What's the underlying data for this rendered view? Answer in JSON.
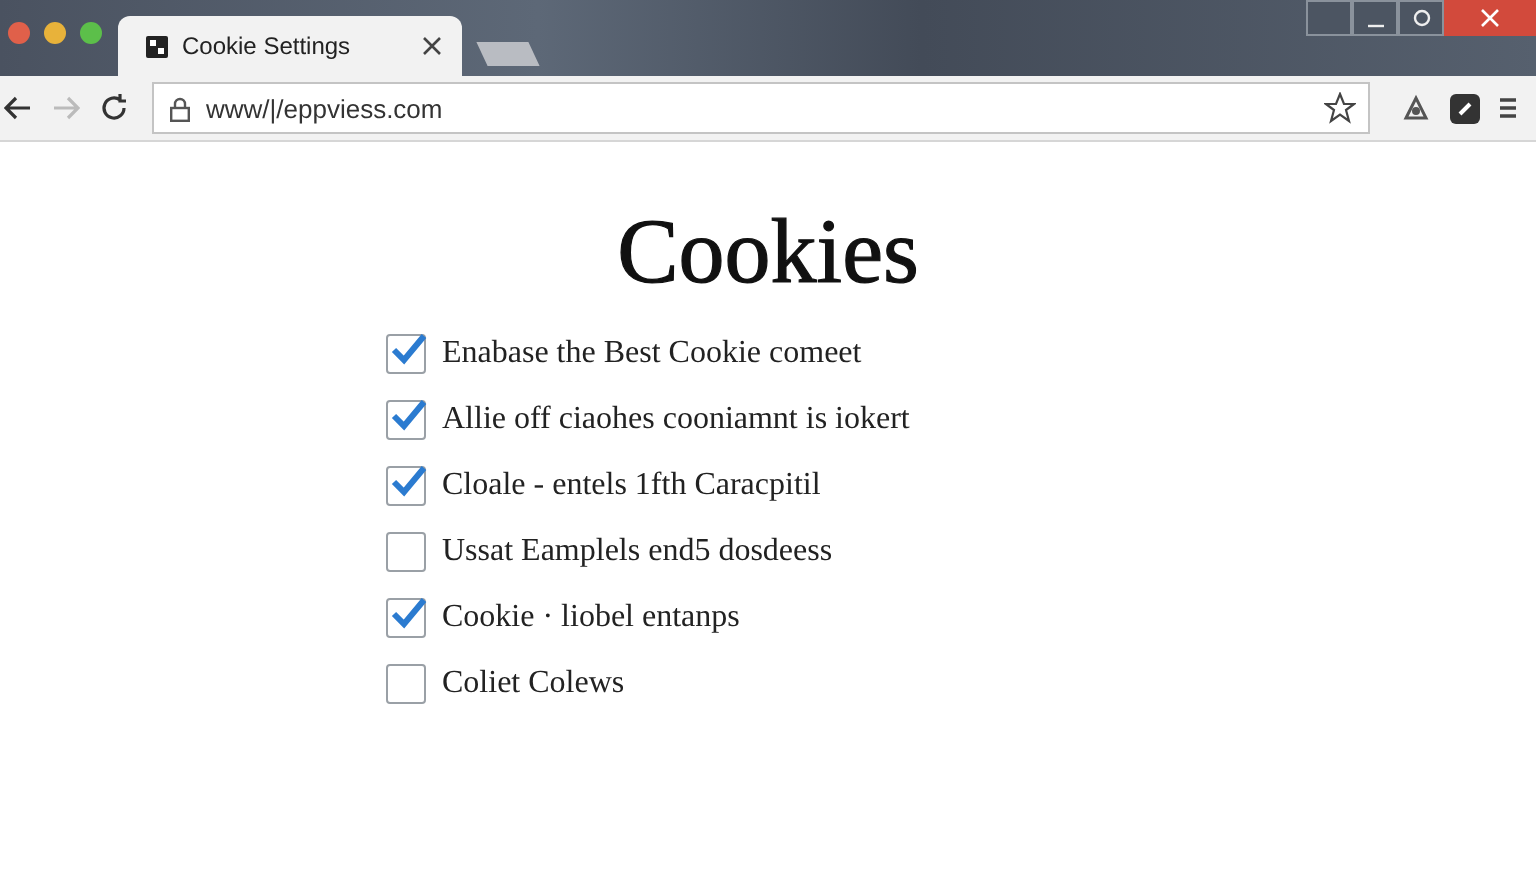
{
  "tab": {
    "title": "Cookie Settings"
  },
  "address_bar": {
    "url": "www/|/eppviess.com"
  },
  "heading": "Cookies",
  "options": [
    {
      "label": "Enabase the Best Cookie comeet",
      "checked": true
    },
    {
      "label": "Allie off ciaohes cooniamnt is iokert",
      "checked": true
    },
    {
      "label": "Cloale - entels 1fth Caracpitil",
      "checked": true
    },
    {
      "label": "Ussat Eamplels end5 dosdeess",
      "checked": false
    },
    {
      "label": "Cookie · liobel entanps",
      "checked": true
    },
    {
      "label": "Coliet Colews",
      "checked": false
    }
  ]
}
